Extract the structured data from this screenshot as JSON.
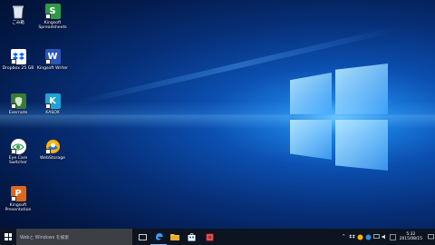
{
  "desktop": {
    "icons": [
      {
        "label": "ごみ箱",
        "icon": "recycle-bin-icon"
      },
      {
        "label": "Kingsoft Spreadsheets",
        "icon": "spreadsheet-icon",
        "color": "#2e9a46"
      },
      {
        "label": "Dropbox 25 GB",
        "icon": "dropbox-icon",
        "color": "#0061fe"
      },
      {
        "label": "Kingsoft Writer",
        "icon": "writer-icon",
        "color": "#2b55b8"
      },
      {
        "label": "Evernote",
        "icon": "evernote-icon",
        "color": "#3b7a3a"
      },
      {
        "label": "KASOX",
        "icon": "kasox-icon",
        "color": "#1fa3d6"
      },
      {
        "label": "Eye Care Switcher",
        "icon": "eye-icon"
      },
      {
        "label": "WebStorage",
        "icon": "webstorage-icon"
      },
      {
        "label": "Kingsoft Presentation",
        "icon": "presentation-icon",
        "color": "#e0661c"
      }
    ]
  },
  "taskbar": {
    "search_placeholder": "Webと Windows を検索",
    "apps": [
      "task-view-icon",
      "edge-icon",
      "file-explorer-icon",
      "store-icon",
      "app-icon"
    ],
    "clock": {
      "time": "5:32",
      "date": "2015/08/15"
    }
  }
}
